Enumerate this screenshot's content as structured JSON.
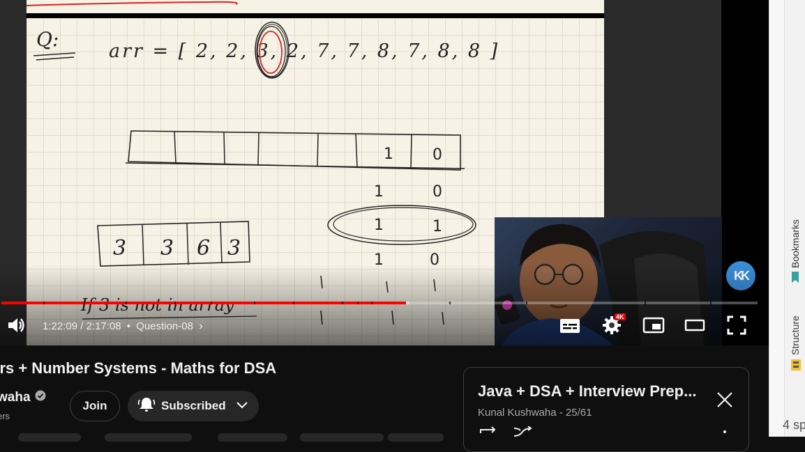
{
  "player": {
    "current_time": "1:22:09",
    "duration": "2:17:08",
    "separator": " / ",
    "bullet": "•",
    "chapter": "Question-08",
    "progress_played": 0.535,
    "progress_loaded": 0.54,
    "quality_badge": "4K",
    "logo_text": "KK"
  },
  "whiteboard": {
    "label": "Q:",
    "array_text": "arr = [ 2, 2, 3, 2, 7, 7, 8, 7, 8, 8 ]",
    "cells": [
      "1",
      "0"
    ],
    "row2": [
      "1",
      "0"
    ],
    "row3": [
      "1",
      "1"
    ],
    "row4": [
      "1",
      "0"
    ],
    "bottom_array": [
      "3",
      "3",
      "6",
      "3"
    ],
    "note": "If 3 is not in array"
  },
  "video": {
    "title": "ors + Number Systems - Maths for DSA",
    "channel": "waha",
    "subscribers": "ers",
    "join_label": "Join",
    "subscribed_label": "Subscribed"
  },
  "playlist": {
    "title": "Java + DSA + Interview Prep...",
    "subtitle": "Kunal Kushwaha - 25/61"
  },
  "sidebar": {
    "bookmarks_label": "Bookmarks",
    "structure_label": "Structure",
    "partial_text": "4 sp"
  },
  "colors": {
    "progress_red": "#ff0000",
    "logo_blue": "#3a8dd8",
    "board": "#f6f2e6"
  }
}
